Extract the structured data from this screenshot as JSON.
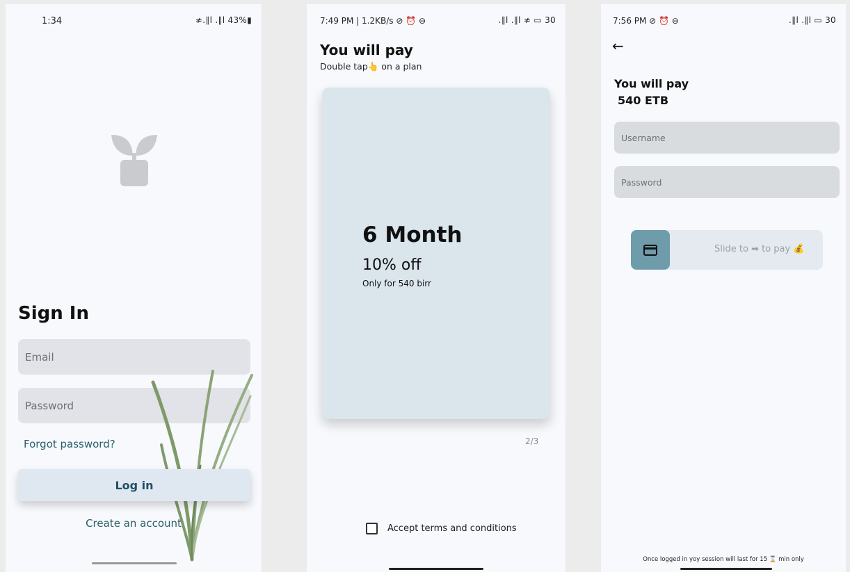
{
  "screen1": {
    "status_time": "1:34",
    "status_right": "≉.∥l .∥l 43%▮",
    "title": "Sign In",
    "email_placeholder": "Email",
    "password_placeholder": "Password",
    "forgot": "Forgot password?",
    "login": "Log in",
    "create": "Create an account"
  },
  "screen2": {
    "status_left": "7:49 PM | 1.2KB/s ⊘ ⏰ ⊖",
    "status_right": ".∥l .∥l ≉ ▭ 30",
    "title": "You will pay",
    "subtitle": "Double tap👆 on a plan",
    "plan_name": "6 Month",
    "plan_discount": "10% off",
    "plan_price": "Only for 540 birr",
    "pager": "2/3",
    "terms": "Accept terms and conditions"
  },
  "screen3": {
    "status_left": "7:56 PM ⊘ ⏰ ⊖",
    "status_right": ".∥l .∥l ▭ 30",
    "back_icon": "←",
    "title": "You will pay",
    "amount": "540 ETB",
    "username_placeholder": "Username",
    "password_placeholder": "Password",
    "slider_text": "Slide to ➡ to pay 💰",
    "session_note": "Once logged in yoy session will last for 15 ⌛ min only"
  }
}
